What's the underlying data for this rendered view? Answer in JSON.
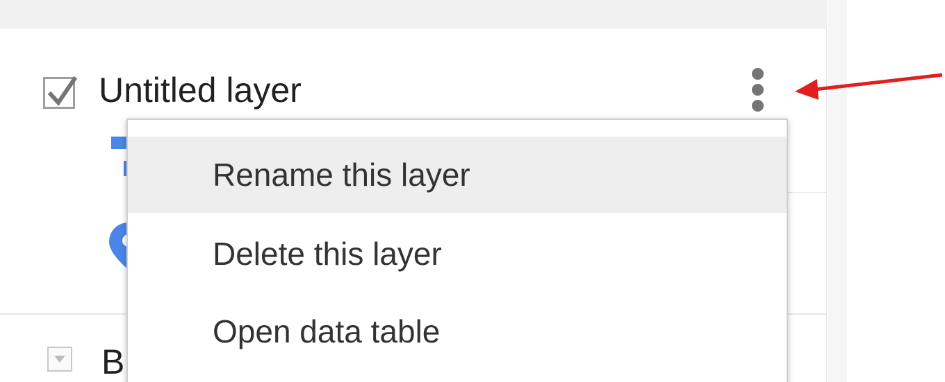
{
  "layer": {
    "title": "Untitled layer",
    "visible": true
  },
  "base_layer": {
    "label_visible": "B"
  },
  "context_menu": {
    "items": [
      {
        "label": "Rename this layer",
        "highlighted": true
      },
      {
        "label": "Delete this layer",
        "highlighted": false
      },
      {
        "label": "Open data table",
        "highlighted": false
      }
    ]
  },
  "icons": {
    "checkbox": "checkbox-checked-icon",
    "more": "more-vert-icon",
    "pin": "map-pin-icon",
    "style": "style-icon",
    "expand": "triangle-down-icon",
    "annotation": "red-arrow"
  },
  "colors": {
    "accent_blue": "#4a86e8",
    "annotation_red": "#e02020",
    "menu_highlight": "#eeeeee"
  }
}
